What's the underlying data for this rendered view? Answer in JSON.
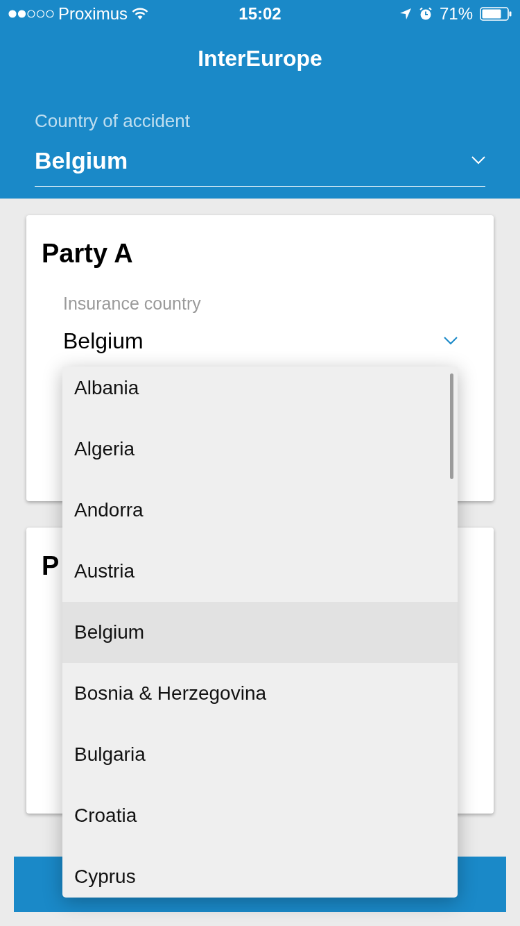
{
  "status_bar": {
    "carrier": "Proximus",
    "time": "15:02",
    "battery": "71%"
  },
  "header": {
    "title": "InterEurope"
  },
  "country_of_accident": {
    "label": "Country of accident",
    "value": "Belgium"
  },
  "parties": [
    {
      "title": "Party A",
      "insurance_country": {
        "label": "Insurance country",
        "value": "Belgium",
        "expanded": true,
        "options": [
          {
            "label": "Albania",
            "selected": false
          },
          {
            "label": "Algeria",
            "selected": false
          },
          {
            "label": "Andorra",
            "selected": false
          },
          {
            "label": "Austria",
            "selected": false
          },
          {
            "label": "Belgium",
            "selected": true
          },
          {
            "label": "Bosnia & Herzegovina",
            "selected": false
          },
          {
            "label": "Bulgaria",
            "selected": false
          },
          {
            "label": "Croatia",
            "selected": false
          },
          {
            "label": "Cyprus",
            "selected": false
          }
        ]
      }
    },
    {
      "title": "P"
    }
  ]
}
